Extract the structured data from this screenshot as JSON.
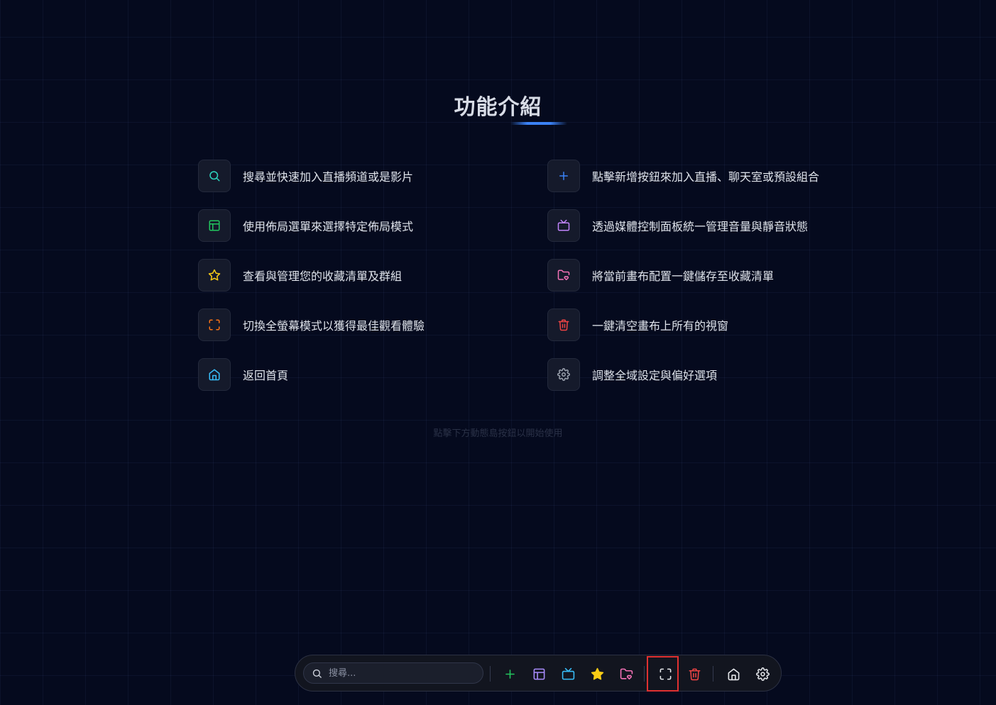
{
  "heading": "功能介紹",
  "features": [
    {
      "icon": "search-icon",
      "color": "#2dd4bf",
      "text": "搜尋並快速加入直播頻道或是影片"
    },
    {
      "icon": "plus-icon",
      "color": "#3b82f6",
      "text": "點擊新增按鈕來加入直播、聊天室或預設組合"
    },
    {
      "icon": "layout-icon",
      "color": "#22c55e",
      "text": "使用佈局選單來選擇特定佈局模式"
    },
    {
      "icon": "tv-icon",
      "color": "#c084fc",
      "text": "透過媒體控制面板統一管理音量與靜音狀態"
    },
    {
      "icon": "star-icon",
      "color": "#facc15",
      "text": "查看與管理您的收藏清單及群組"
    },
    {
      "icon": "folder-heart-icon",
      "color": "#f472b6",
      "text": "將當前畫布配置一鍵儲存至收藏清單"
    },
    {
      "icon": "fullscreen-icon",
      "color": "#f97316",
      "text": "切換全螢幕模式以獲得最佳觀看體驗"
    },
    {
      "icon": "trash-icon",
      "color": "#ef4444",
      "text": "一鍵清空畫布上所有的視窗"
    },
    {
      "icon": "home-icon",
      "color": "#38bdf8",
      "text": "返回首頁"
    },
    {
      "icon": "settings-icon",
      "color": "#9ca3af",
      "text": "調整全域設定與偏好選項"
    }
  ],
  "hint": "點擊下方動態島按鈕以開始使用",
  "dock": {
    "search_placeholder": "搜尋...",
    "buttons": [
      {
        "name": "add-button",
        "icon": "plus-icon",
        "color": "#22c55e"
      },
      {
        "name": "layout-button",
        "icon": "layout-icon",
        "color": "#a78bfa"
      },
      {
        "name": "media-button",
        "icon": "tv-icon",
        "color": "#38bdf8"
      },
      {
        "name": "favorites-button",
        "icon": "star-filled-icon",
        "color": "#facc15"
      },
      {
        "name": "save-favorite-button",
        "icon": "folder-heart-icon",
        "color": "#f472b6"
      },
      {
        "name": "fullscreen-button",
        "icon": "fullscreen-icon",
        "color": "#e5e7eb"
      },
      {
        "name": "clear-button",
        "icon": "trash-icon",
        "color": "#ef4444"
      },
      {
        "name": "home-button",
        "icon": "home-icon",
        "color": "#e5e7eb"
      },
      {
        "name": "settings-button",
        "icon": "settings-icon",
        "color": "#e5e7eb"
      }
    ]
  }
}
